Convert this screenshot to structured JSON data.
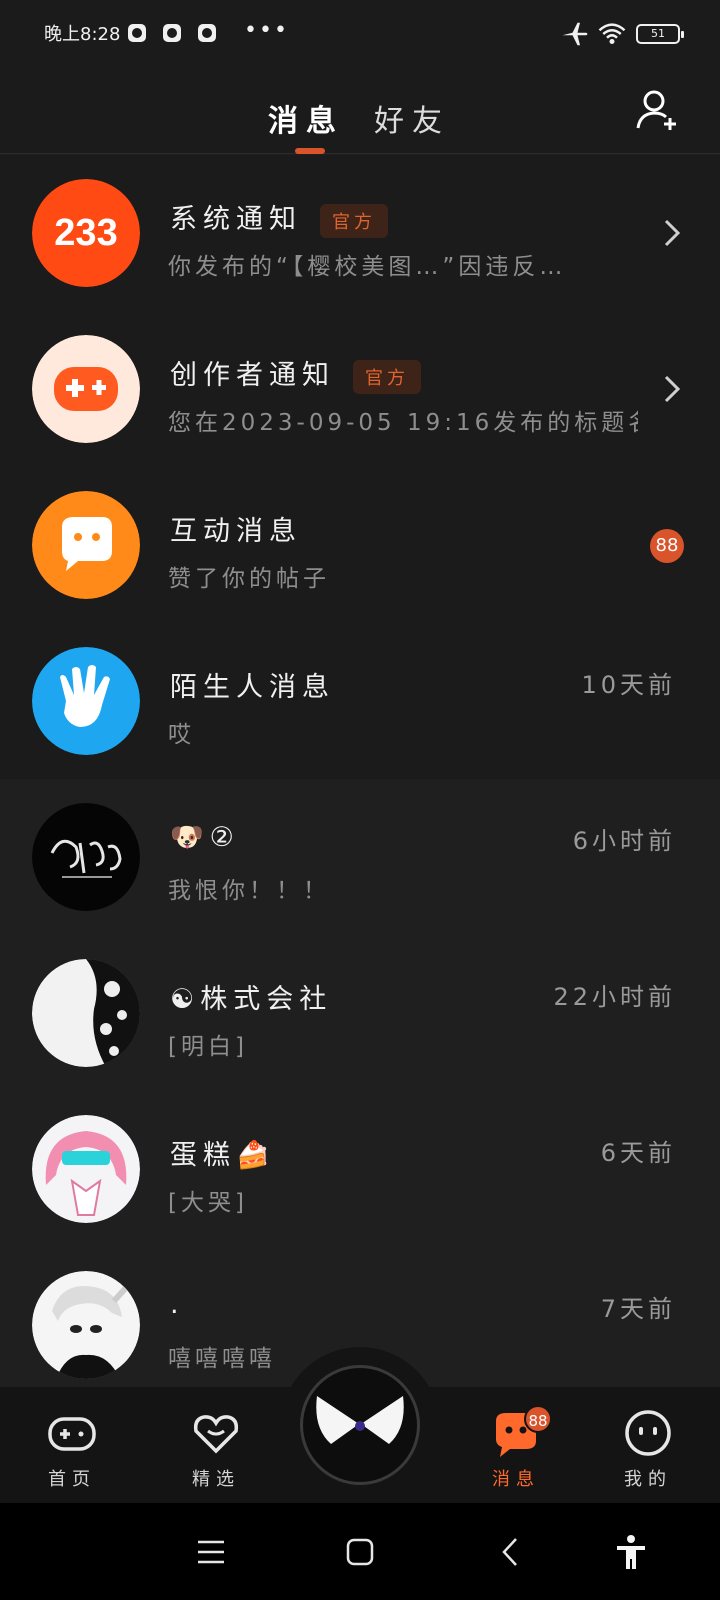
{
  "status_bar": {
    "time": "晚上8:28",
    "more": "•••",
    "battery": "51"
  },
  "header": {
    "tabs": [
      {
        "label": "消息",
        "active": true
      },
      {
        "label": "好友",
        "active": false
      }
    ],
    "add_friend_icon": "add-user-icon",
    "accent_color": "#d9532b"
  },
  "messages": [
    {
      "name": "系统通知",
      "tag": "官方",
      "preview": "你发布的“【樱校美图…”因违反…",
      "time": "",
      "badge": "",
      "avatar": "233"
    },
    {
      "name": "创作者通知",
      "tag": "官方",
      "preview": "您在2023-09-05 19:16发布的标题名…",
      "time": "",
      "badge": "",
      "avatar": "gamepad"
    },
    {
      "name": "互动消息",
      "tag": "",
      "preview": "赞了你的帖子",
      "time": "",
      "badge": "88",
      "avatar": "chat-bubble"
    },
    {
      "name": "陌生人消息",
      "tag": "",
      "preview": "哎",
      "time": "10天前",
      "badge": "",
      "avatar": "hand"
    },
    {
      "name": "🐶②",
      "tag": "",
      "preview": "我恨你！！！",
      "time": "6小时前",
      "badge": "",
      "avatar": "logo-dark"
    },
    {
      "name": "☯株式会社",
      "tag": "",
      "preview": "[明白]",
      "time": "22小时前",
      "badge": "",
      "avatar": "butterfly-pattern"
    },
    {
      "name": "蛋糕🍰",
      "tag": "",
      "preview": "[大哭]",
      "time": "6天前",
      "badge": "",
      "avatar": "pink-hair-character"
    },
    {
      "name": ".",
      "tag": "",
      "preview": "嘻嘻嘻嘻",
      "time": "7天前",
      "badge": "",
      "avatar": "white-hair-character"
    }
  ],
  "bottom_nav": {
    "items": [
      {
        "label": "首页",
        "icon": "gamepad-icon",
        "active": false
      },
      {
        "label": "精选",
        "icon": "heart-icon",
        "active": false
      },
      {
        "label": "消息",
        "icon": "message-icon",
        "active": true,
        "badge": "88"
      },
      {
        "label": "我的",
        "icon": "face-icon",
        "active": false
      }
    ],
    "center_icon": "butterfly-icon"
  },
  "system_nav": {
    "buttons": [
      "menu-icon",
      "home-icon",
      "back-icon",
      "accessibility-icon"
    ]
  }
}
